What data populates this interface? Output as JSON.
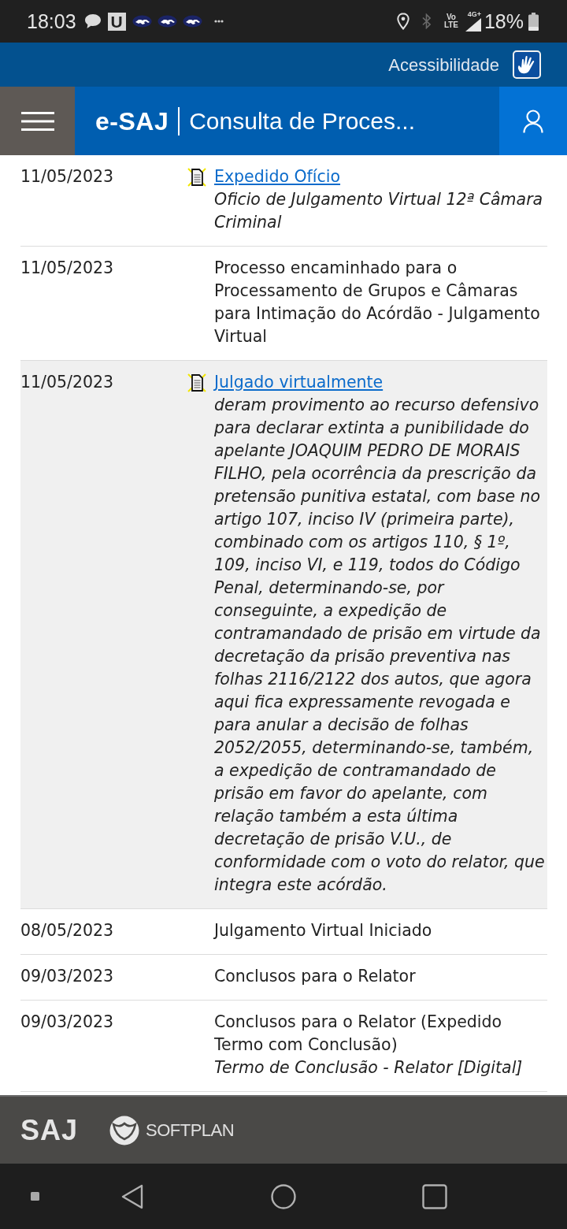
{
  "status_bar": {
    "time": "18:03",
    "app_letter": "U",
    "volte": "Vo LTE",
    "network": "4G+",
    "battery": "18%"
  },
  "accessibility_bar": {
    "label": "Acessibilidade"
  },
  "header": {
    "brand": "e-SAJ",
    "title": "Consulta de Proces..."
  },
  "movements": [
    {
      "date": "11/05/2023",
      "kind": "document",
      "title": "Expedido Ofício",
      "detail": "Oficio de Julgamento Virtual 12ª Câmara Criminal",
      "highlighted": false
    },
    {
      "date": "11/05/2023",
      "kind": "plain",
      "title": "Processo encaminhado para o Processamento de Grupos e Câmaras para Intimação do Acórdão - Julgamento Virtual",
      "highlighted": false
    },
    {
      "date": "11/05/2023",
      "kind": "document",
      "title": "Julgado virtualmente",
      "detail": "deram provimento ao recurso defensivo para declarar extinta a punibilidade do apelante JOAQUIM PEDRO DE MORAIS FILHO, pela ocorrência da prescrição da pretensão punitiva estatal, com base no artigo 107, inciso IV (primeira parte), combinado com os artigos 110, § 1º, 109, inciso VI, e 119, todos do Código Penal, determinando-se, por conseguinte, a expedição de contramandado de prisão em virtude da decretação da prisão preventiva nas folhas 2116/2122 dos autos, que agora aqui fica expressamente revogada e para anular a decisão de folhas 2052/2055, determinando-se, também, a expedição de contramandado de prisão em favor do apelante, com relação também a esta última decretação de prisão V.U., de conformidade com o voto do relator, que integra este acórdão.",
      "highlighted": true
    },
    {
      "date": "08/05/2023",
      "kind": "plain",
      "title": "Julgamento Virtual Iniciado",
      "highlighted": false
    },
    {
      "date": "09/03/2023",
      "kind": "plain",
      "title": "Conclusos para o Relator",
      "highlighted": false
    },
    {
      "date": "09/03/2023",
      "kind": "plain",
      "title": "Conclusos para o Relator (Expedido Termo com Conclusão)",
      "detail": "Termo de Conclusão - Relator [Digital]",
      "highlighted": false
    }
  ],
  "footer": {
    "saj_logo": "SAJ",
    "softplan_logo": "SOFTPLAN"
  }
}
